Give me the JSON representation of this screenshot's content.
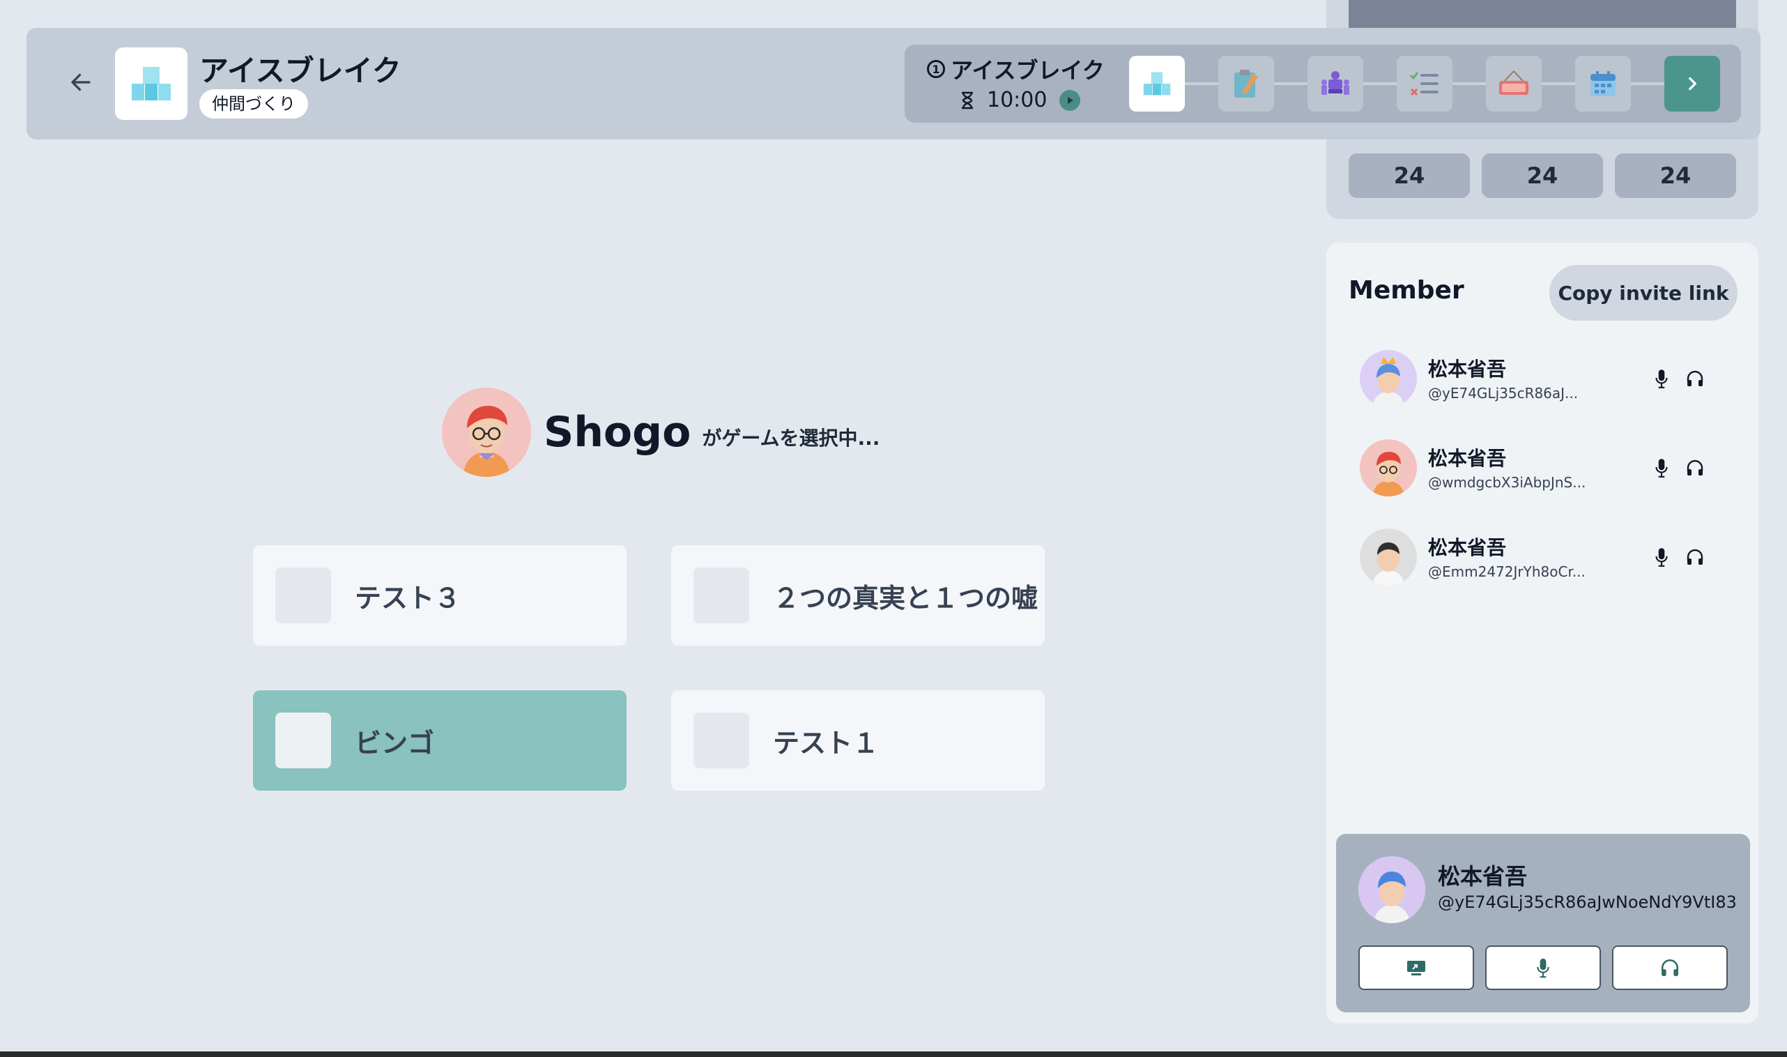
{
  "header": {
    "title": "アイスブレイク",
    "tag": "仲間づくり"
  },
  "stepper": {
    "current_step_number": "1",
    "current_step_title": "アイスブレイク",
    "timer": "10:00",
    "steps": [
      {
        "icon": "blocks-icon",
        "active": true
      },
      {
        "icon": "notepad-icon",
        "active": false
      },
      {
        "icon": "meeting-icon",
        "active": false
      },
      {
        "icon": "checklist-icon",
        "active": false
      },
      {
        "icon": "close-sign-icon",
        "active": false
      },
      {
        "icon": "calendar-icon",
        "active": false
      }
    ]
  },
  "stats": {
    "values": [
      "24",
      "24",
      "24"
    ]
  },
  "selector": {
    "name": "Shogo",
    "status": "がゲームを選択中..."
  },
  "games": [
    {
      "label": "テスト３",
      "selected": false
    },
    {
      "label": "２つの真実と１つの嘘",
      "selected": false
    },
    {
      "label": "ビンゴ",
      "selected": true
    },
    {
      "label": "テスト１",
      "selected": false
    }
  ],
  "members": {
    "title": "Member",
    "invite_label": "Copy invite link",
    "list": [
      {
        "name": "松本省吾",
        "handle": "@yE74GLj35cR86aJ...",
        "crown": true
      },
      {
        "name": "松本省吾",
        "handle": "@wmdgcbX3iAbpJnS...",
        "crown": false
      },
      {
        "name": "松本省吾",
        "handle": "@Emm2472JrYh8oCr...",
        "crown": false
      }
    ]
  },
  "self": {
    "name": "松本省吾",
    "handle": "@yE74GLj35cR86aJwNoeNdY9VtI83"
  },
  "colors": {
    "accent": "#4b958d",
    "selected_card": "#89c2be"
  }
}
